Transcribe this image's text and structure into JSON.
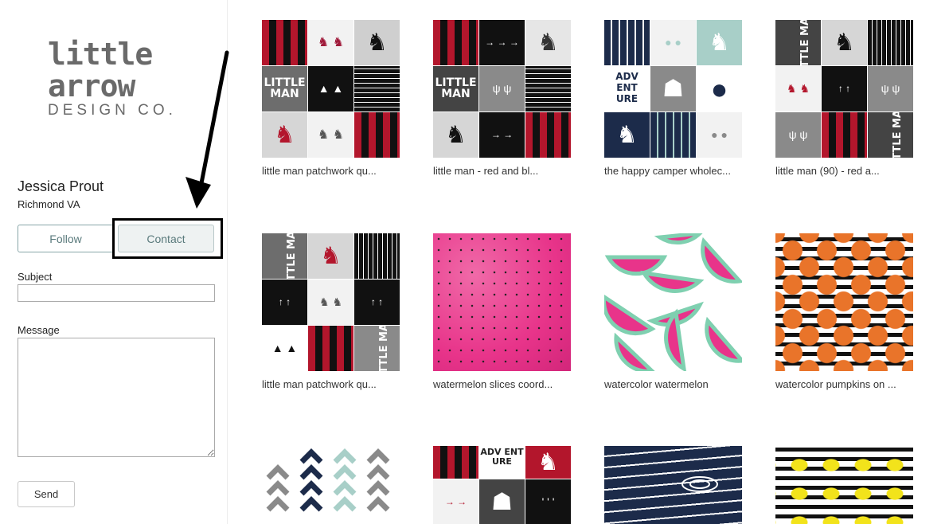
{
  "profile": {
    "logo_main": "little arrow",
    "logo_sub": "DESIGN CO.",
    "name": "Jessica Prout",
    "location": "Richmond VA",
    "follow_label": "Follow",
    "contact_label": "Contact"
  },
  "contact_form": {
    "subject_label": "Subject",
    "subject_value": "",
    "message_label": "Message",
    "message_value": "",
    "send_label": "Send"
  },
  "designs": [
    {
      "title": "little man patchwork qu..."
    },
    {
      "title": "little man - red and bl..."
    },
    {
      "title": "the happy camper wholec..."
    },
    {
      "title": "little man (90) - red a..."
    },
    {
      "title": "little man patchwork qu..."
    },
    {
      "title": "watermelon slices coord..."
    },
    {
      "title": "watercolor watermelon"
    },
    {
      "title": "watercolor pumpkins on ..."
    },
    {
      "title": ""
    },
    {
      "title": ""
    },
    {
      "title": ""
    },
    {
      "title": ""
    }
  ],
  "tile_text": {
    "little_man": "LITTLE MAN",
    "adventure": "ADV ENT URE"
  },
  "colors": {
    "buffalo_red": "#b3162c",
    "black": "#111111",
    "grey": "#6d6d6d",
    "navy": "#1c2b4a",
    "mint": "#a8cfc8",
    "pink": "#e8348a",
    "accent_border": "#88a6a8"
  }
}
